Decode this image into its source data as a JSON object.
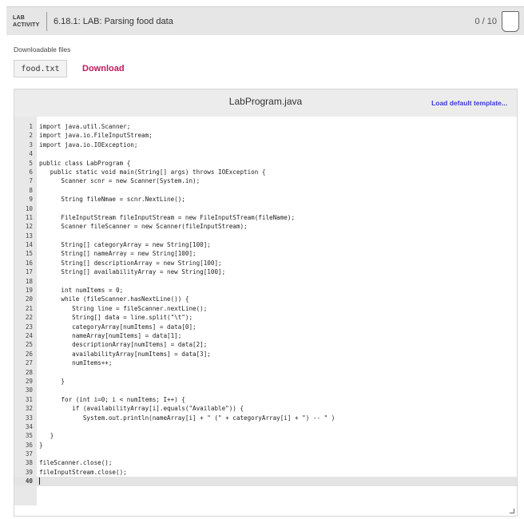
{
  "header": {
    "badge_line1": "LAB",
    "badge_line2": "ACTIVITY",
    "title": "6.18.1: LAB: Parsing food data",
    "score": "0 / 10"
  },
  "downloads": {
    "label": "Downloadable files",
    "file_name": "food.txt",
    "download_label": "Download"
  },
  "editor": {
    "file_name": "LabProgram.java",
    "load_template_label": "Load default template...",
    "lines": [
      "import java.util.Scanner;",
      "import java.io.FileInputStream;",
      "import java.io.IOException;",
      "",
      "public class LabProgram {",
      "   public static void main(String[] args) throws IOException {",
      "      Scanner scnr = new Scanner(System.in);",
      "",
      "      String fileNmae = scnr.NextLine();",
      "",
      "      FileInputStream fileInputStream = new FileInputSTream(fileName);",
      "      Scanner fileScanner = new Scanner(fileInputStream);",
      "",
      "      String[] categoryArray = new String[100];",
      "      String[] nameArray = new String[100];",
      "      String[] descriptionArray = new String[100];",
      "      String[] availabilityArray = new String[100];",
      "",
      "      int numItems = 0;",
      "      while (fileScanner.hasNextLine()) {",
      "         String line = fileScanner.nextLine();",
      "         String[] data = line.split(\"\\t\");",
      "         categoryArray[numItems] = data[0];",
      "         nameArray[numItems] = data[1];",
      "         descriptionArray[numItems] = data[2];",
      "         availabilityArray[numItems] = data[3];",
      "         numItems++;",
      "",
      "      }",
      "",
      "      for (int i=0; i < numItems; I++) {",
      "         if (availabilityArray[i].equals(\"Available\")) {",
      "            System.out.println(nameArray[i] + \" (\" + categoryArray[i] + \") -- \" )",
      "",
      "   }",
      "}",
      "",
      "fileScanner.close();",
      "fileInputStream.close();",
      ""
    ],
    "active_line": 40
  },
  "colors": {
    "download_link": "#c2185b",
    "template_link": "#3b3bd6",
    "header_bg": "#e6e6e6"
  }
}
